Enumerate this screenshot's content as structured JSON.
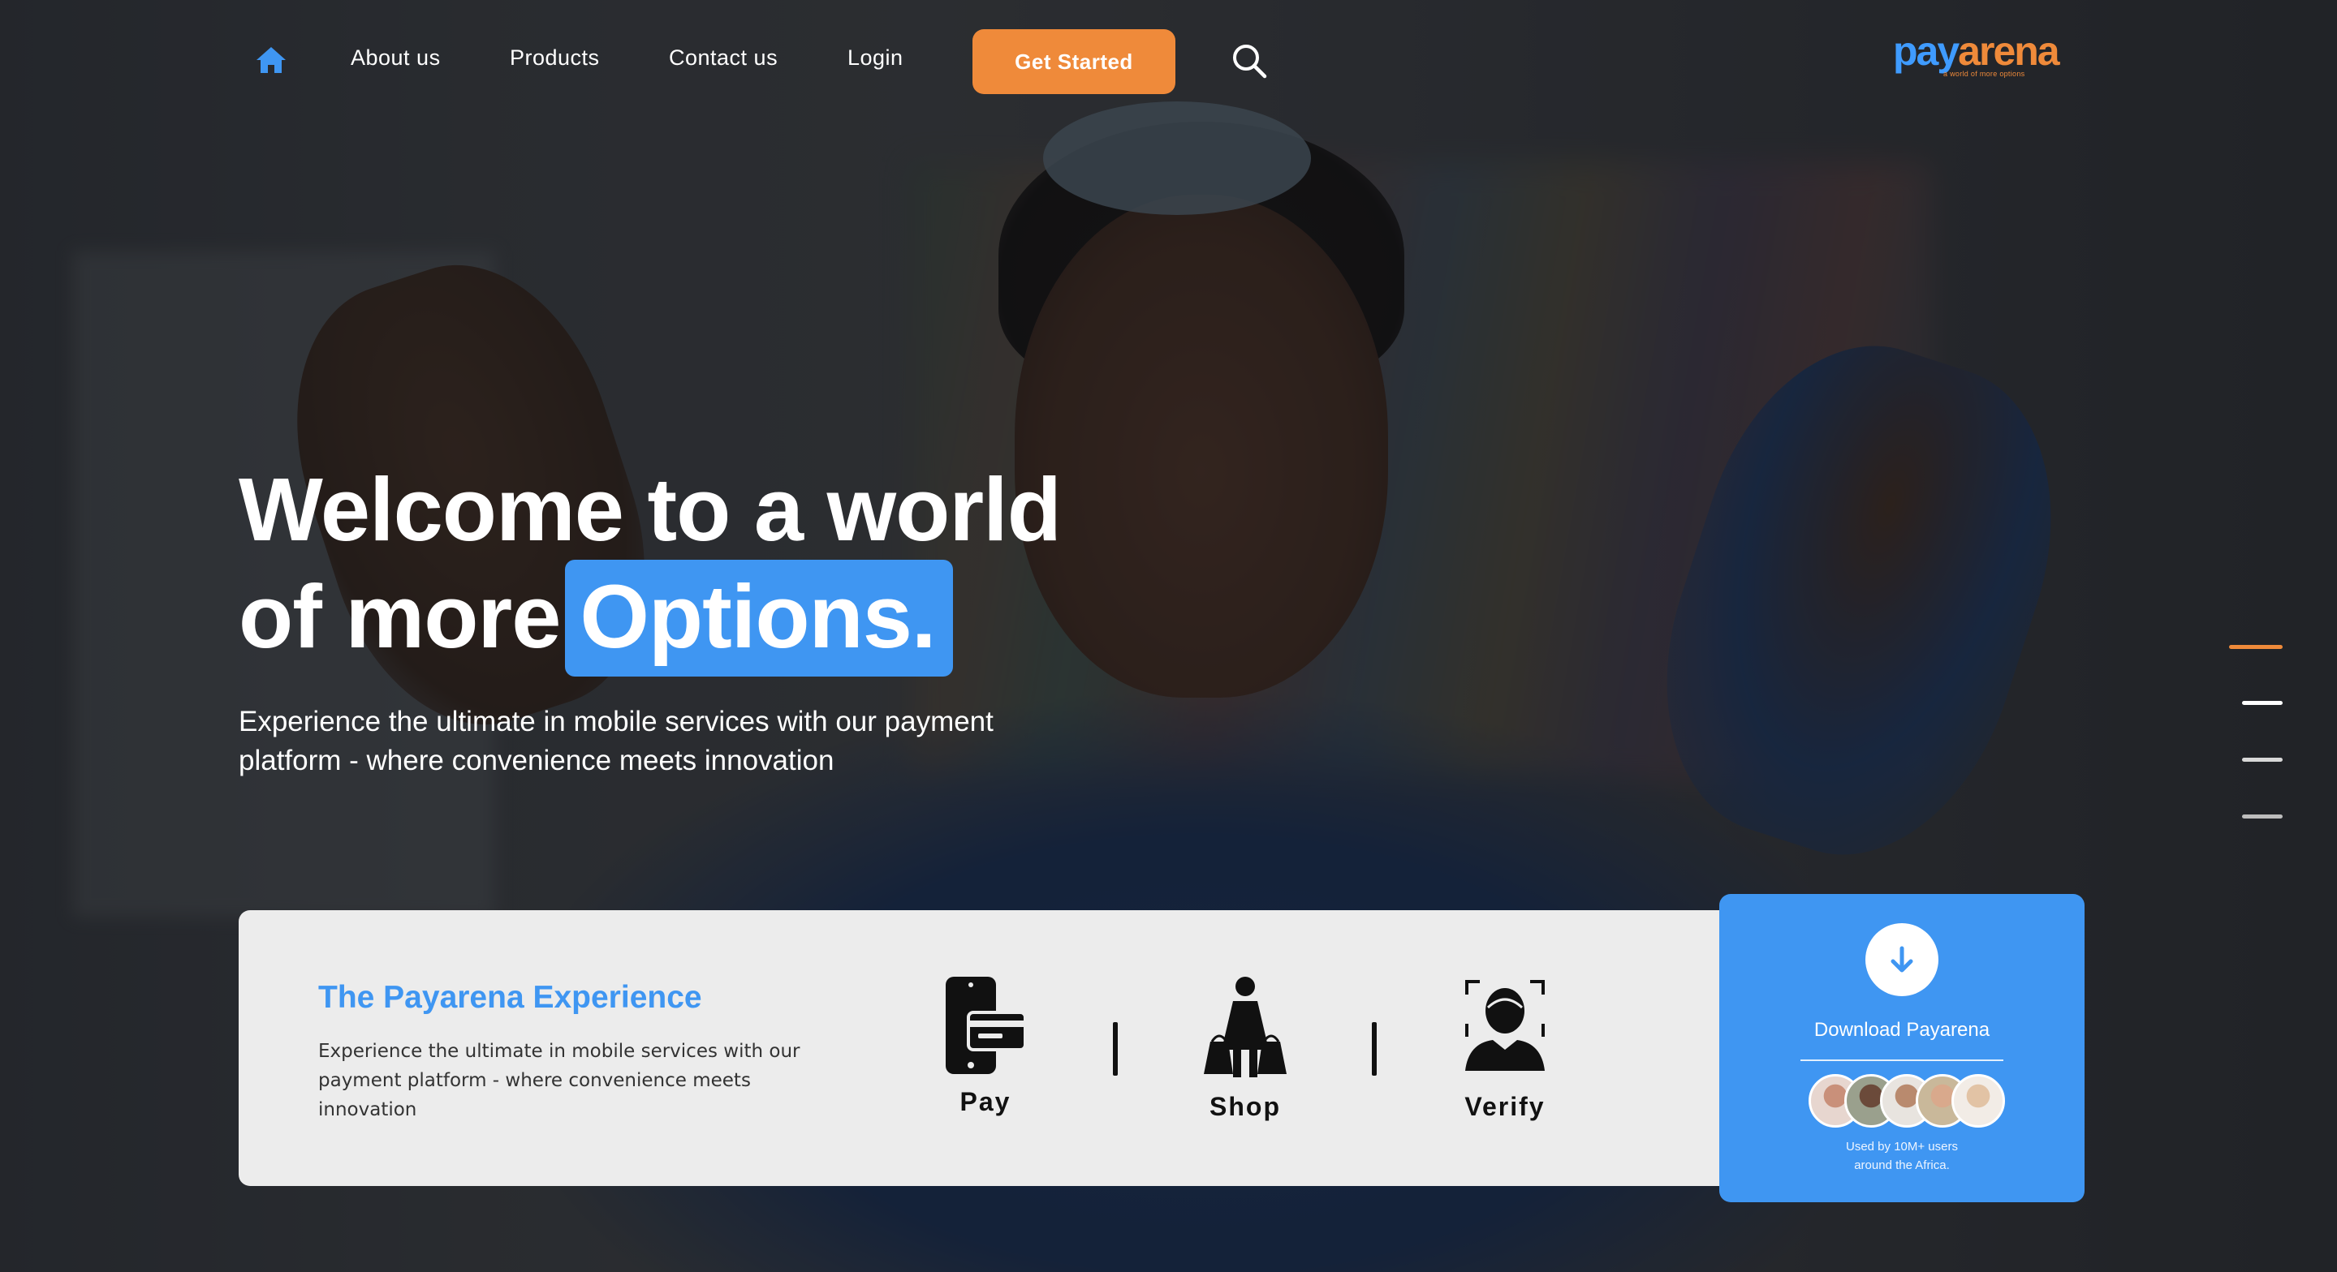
{
  "nav": {
    "home_icon": "home-icon",
    "links": [
      "About us",
      "Products",
      "Contact us",
      "Login"
    ],
    "cta_label": "Get Started",
    "search_icon": "search-icon"
  },
  "logo": {
    "pay": "pay",
    "arena": "arena",
    "tagline": "a world of more options"
  },
  "hero": {
    "title_line1": "Welcome to a world",
    "title_line2_prefix": "of more",
    "title_highlight": "Options.",
    "subtitle": "Experience the ultimate in mobile services with our payment platform - where convenience meets innovation"
  },
  "indicators": {
    "count": 4,
    "active_index": 0
  },
  "experience": {
    "title": "The Payarena Experience",
    "description": "Experience the ultimate in mobile services with our payment platform - where convenience meets innovation",
    "features": [
      {
        "label": "Pay",
        "icon": "mobile-card-icon"
      },
      {
        "label": "Shop",
        "icon": "shopper-bags-icon"
      },
      {
        "label": "Verify",
        "icon": "face-scan-icon"
      }
    ]
  },
  "download": {
    "icon": "arrow-down-icon",
    "label": "Download Payarena",
    "note_line1": "Used by 10M+ users",
    "note_line2": "around the Africa."
  },
  "colors": {
    "accent_blue": "#3f96f2",
    "accent_orange": "#ef8a3a",
    "card_bg": "#ececec"
  }
}
